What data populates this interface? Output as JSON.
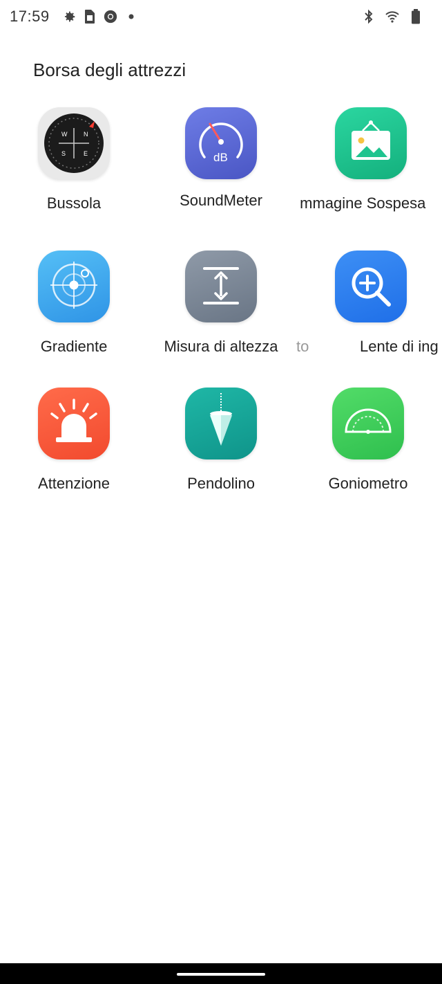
{
  "status_bar": {
    "time": "17:59",
    "left_icons": [
      "gear-icon",
      "sim-card-icon",
      "chrome-icon",
      "dot-icon"
    ],
    "right_icons": [
      "bluetooth-icon",
      "wifi-icon",
      "battery-icon"
    ]
  },
  "page": {
    "title": "Borsa degli attrezzi"
  },
  "apps": [
    {
      "label": "Bussola",
      "icon": "compass-icon"
    },
    {
      "label": "SoundMeter",
      "icon": "sound-meter-icon"
    },
    {
      "label": "Immagine Sospesa",
      "icon": "hanging-picture-icon"
    },
    {
      "label": "Gradiente",
      "icon": "level-icon"
    },
    {
      "label": "Misura di altezza",
      "icon": "height-measure-icon",
      "trailing_fragment": "to"
    },
    {
      "label": "Lente di ing",
      "icon": "magnifier-icon"
    },
    {
      "label": "Attenzione",
      "icon": "alert-light-icon"
    },
    {
      "label": "Pendolino",
      "icon": "plumb-bob-icon"
    },
    {
      "label": "Goniometro",
      "icon": "protractor-icon"
    }
  ],
  "colors": {
    "compass_bg": "#e9e9e9",
    "sound_meter": "#5a67d8",
    "hanging_picture": "#1fc48f",
    "level": "#3aa6ef",
    "height_measure": "#7d8a99",
    "magnifier": "#2f7ff0",
    "alert": "#ff5a3c",
    "plumb": "#17a59a",
    "protractor": "#3fcf5b"
  }
}
